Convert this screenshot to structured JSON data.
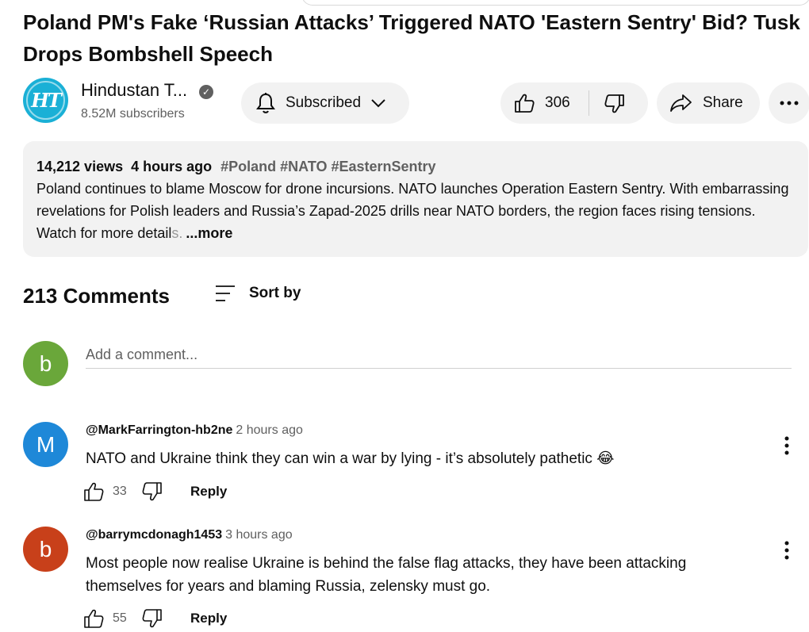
{
  "video": {
    "title": "Poland PM's Fake ‘Russian Attacks’ Triggered NATO 'Eastern Sentry' Bid? Tusk Drops Bombshell Speech"
  },
  "channel": {
    "avatar_text": "HT",
    "name": "Hindustan T...",
    "subscribers": "8.52M subscribers",
    "subscribe_label": "Subscribed"
  },
  "actions": {
    "like_count": "306",
    "share_label": "Share"
  },
  "description": {
    "views": "14,212 views",
    "age": "4 hours ago",
    "tags": "#Poland #NATO #EasternSentry",
    "text": "Poland continues to blame Moscow for drone incursions. NATO launches Operation Eastern Sentry. With embarrassing revelations for Polish leaders and Russia’s Zapad-2025 drills near NATO borders, the region faces rising tensions. Watch for more detail",
    "faded_tail": "s.",
    "more_label": "...more"
  },
  "comments_section": {
    "count_label": "213 Comments",
    "sort_label": "Sort by",
    "me_avatar": "b",
    "add_placeholder": "Add a comment...",
    "items": [
      {
        "avatar": "M",
        "avatar_color": "#1e88d8",
        "author": "@MarkFarrington-hb2ne",
        "time": "2 hours ago",
        "text": "NATO and Ukraine think they can win a war by lying - it’s absolutely pathetic 😂",
        "likes": "33",
        "reply_label": "Reply"
      },
      {
        "avatar": "b",
        "avatar_color": "#c8401a",
        "author": "@barrymcdonagh1453",
        "time": "3 hours ago",
        "text": "Most people now realise Ukraine is behind the false flag attacks, they have been attacking themselves for years  and blaming Russia, zelensky must go.",
        "likes": "55",
        "reply_label": "Reply"
      }
    ]
  },
  "icons": [
    "verified-check-icon",
    "bell-icon",
    "chevron-down-icon",
    "thumbs-up-icon",
    "thumbs-down-icon",
    "share-arrow-icon",
    "more-horizontal-icon",
    "sort-lines-icon",
    "more-vertical-icon"
  ]
}
